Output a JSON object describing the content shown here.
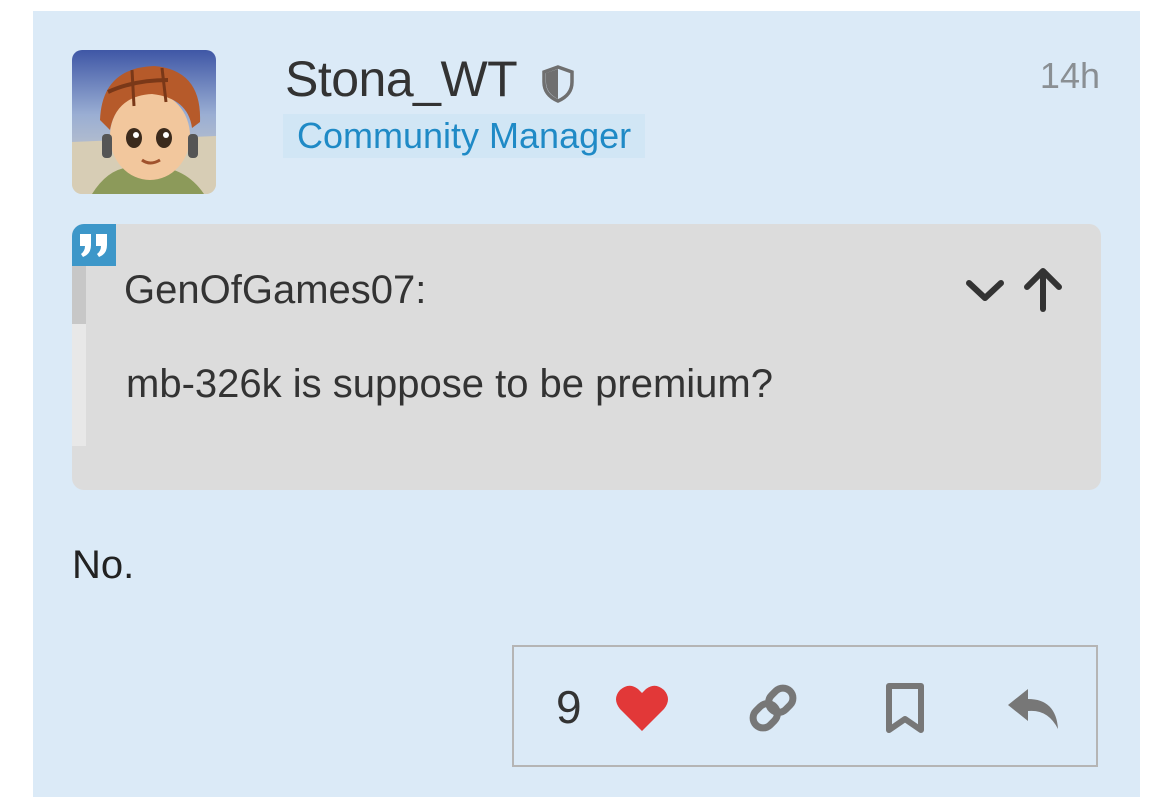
{
  "post": {
    "username": "Stona_WT",
    "user_title": "Community Manager",
    "time": "14h",
    "body": "No."
  },
  "quote": {
    "author": "GenOfGames07:",
    "text": "mb-326k is suppose to be premium?"
  },
  "actions": {
    "like_count": "9"
  },
  "icons": {
    "moderator": "shield-icon",
    "quote": "quote-icon",
    "expand": "chevron-down-icon",
    "goto": "arrow-up-icon",
    "like": "heart-icon",
    "share": "link-icon",
    "bookmark": "bookmark-icon",
    "reply": "reply-icon"
  },
  "colors": {
    "post_background": "#dbeaf7",
    "user_title_text": "#1f8ac6",
    "user_title_background": "#d1e6f5",
    "quote_background": "#dcdcdc",
    "quote_icon": "#3d97c9",
    "heart": "#e23838",
    "action_icons": "#777777"
  }
}
